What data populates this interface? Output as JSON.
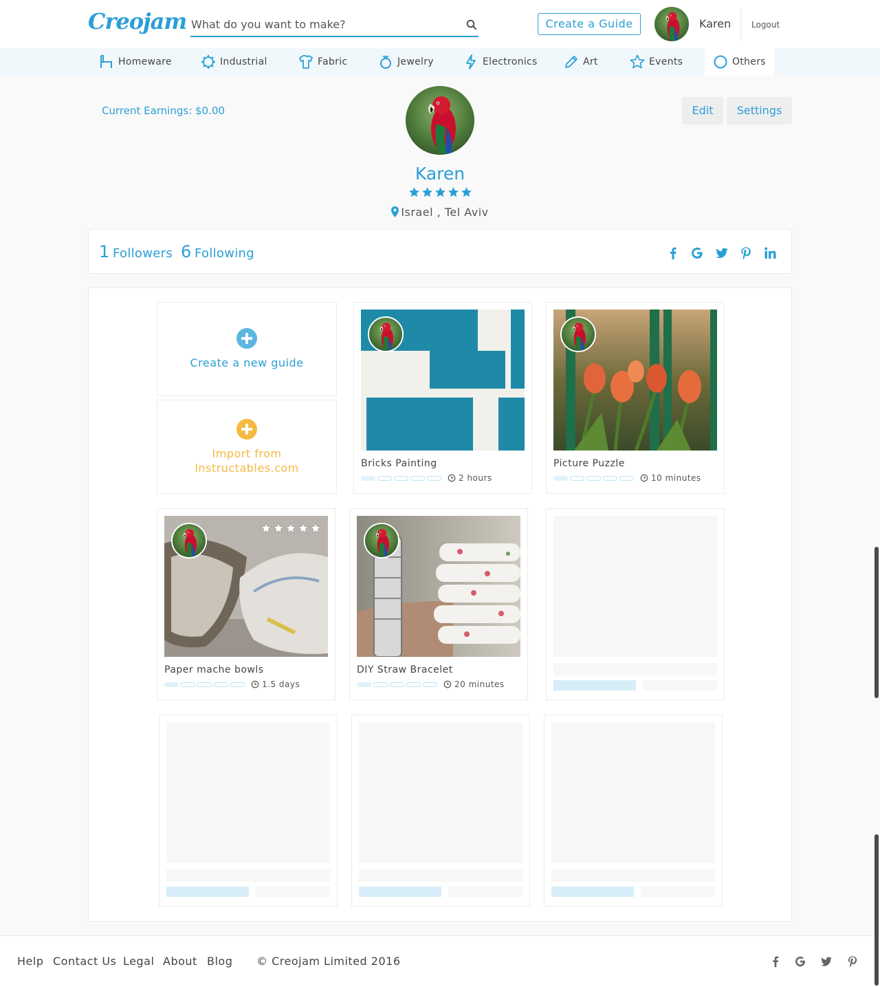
{
  "header": {
    "logo": "Creojam",
    "search_placeholder": "What do you want to make?",
    "create_guide": "Create a Guide",
    "user_name": "Karen",
    "logout": "Logout"
  },
  "categories": [
    {
      "label": "Homeware",
      "icon": "chair-icon"
    },
    {
      "label": "Industrial",
      "icon": "gear-icon"
    },
    {
      "label": "Fabric",
      "icon": "shirt-icon"
    },
    {
      "label": "Jewelry",
      "icon": "ring-icon"
    },
    {
      "label": "Electronics",
      "icon": "lightning-icon"
    },
    {
      "label": "Art",
      "icon": "pencil-icon"
    },
    {
      "label": "Events",
      "icon": "star-icon"
    },
    {
      "label": "Others",
      "icon": "circle-icon"
    }
  ],
  "profile": {
    "earnings": "Current Earnings: $0.00",
    "edit": "Edit",
    "settings": "Settings",
    "name": "Karen",
    "rating": 5,
    "location": "Israel , Tel Aviv",
    "followers_count": "1",
    "followers_label": "Followers",
    "following_count": "6",
    "following_label": "Following",
    "social": [
      "facebook-icon",
      "google-icon",
      "twitter-icon",
      "pinterest-icon",
      "linkedin-icon"
    ]
  },
  "actions": {
    "create_new_guide": "Create a new guide",
    "import_line1": "Import from",
    "import_line2": "Instructables.com"
  },
  "guides": [
    {
      "title": "Bricks Painting",
      "duration": "2 hours",
      "difficulty": 1
    },
    {
      "title": "Picture Puzzle",
      "duration": "10 minutes",
      "difficulty": 1
    },
    {
      "title": "Paper mache bowls",
      "duration": "1.5 days",
      "difficulty": 1,
      "rating": 5
    },
    {
      "title": "DIY Straw Bracelet",
      "duration": "20 minutes",
      "difficulty": 1
    }
  ],
  "footer": {
    "links": [
      "Help",
      "Contact Us",
      "Legal",
      "About",
      "Blog"
    ],
    "copyright": "© Creojam Limited 2016",
    "social": [
      "facebook-icon",
      "google-icon",
      "twitter-icon",
      "pinterest-icon"
    ]
  },
  "colors": {
    "accent": "#2a9fd6",
    "import_accent": "#f5b942",
    "category_bar": "#f1f8fc"
  }
}
